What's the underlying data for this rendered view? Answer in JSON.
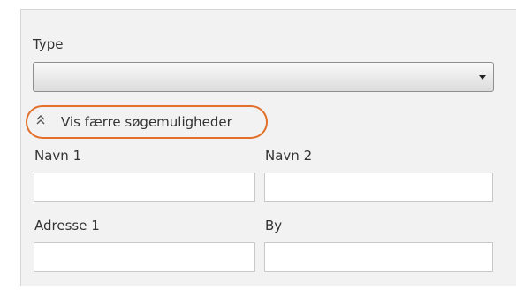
{
  "type_field": {
    "label": "Type",
    "selected_value": ""
  },
  "toggle": {
    "label": "Vis færre søgemuligheder",
    "icon": "double-chevron-up-icon",
    "highlight_color": "#e2702a"
  },
  "fields": {
    "navn1": {
      "label": "Navn 1",
      "value": ""
    },
    "navn2": {
      "label": "Navn 2",
      "value": ""
    },
    "adresse1": {
      "label": "Adresse 1",
      "value": ""
    },
    "by": {
      "label": "By",
      "value": ""
    }
  }
}
